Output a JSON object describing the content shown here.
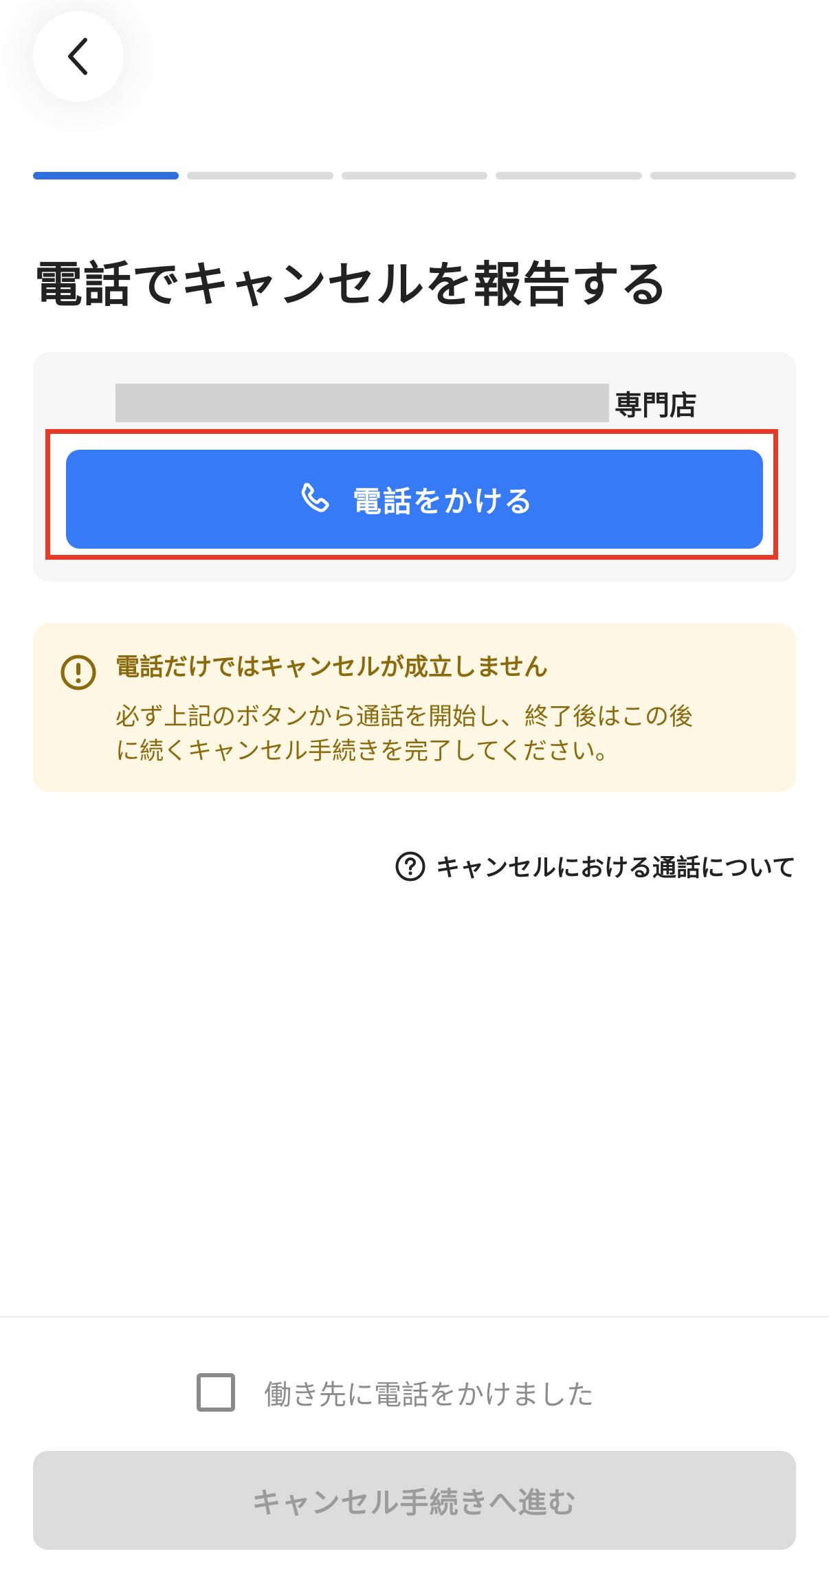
{
  "header": {
    "back_icon": "chevron-left-icon"
  },
  "progress": {
    "total_steps": 5,
    "current_step": 1,
    "active_color": "#2f6fde",
    "inactive_color": "#dcdcdc"
  },
  "title": "電話でキャンセルを報告する",
  "store": {
    "name_suffix": "専門店",
    "name_redacted": true
  },
  "call_button": {
    "label": "電話をかける",
    "icon": "phone-icon",
    "color": "#367bf5"
  },
  "highlight_color": "#e63a26",
  "warning": {
    "icon": "exclamation-circle-icon",
    "title": "電話だけではキャンセルが成立しません",
    "line1": "必ず上記のボタンから通話を開始し、終了後はこの後",
    "line2": "に続くキャンセル手続きを完了してください。",
    "text_color": "#8a6a0c",
    "background": "#fdf7e3"
  },
  "help_link": {
    "icon": "question-circle-icon",
    "label": "キャンセルにおける通話について"
  },
  "footer": {
    "checkbox_label": "働き先に電話をかけました",
    "checkbox_checked": false,
    "proceed_label": "キャンセル手続きへ進む",
    "proceed_enabled": false
  }
}
